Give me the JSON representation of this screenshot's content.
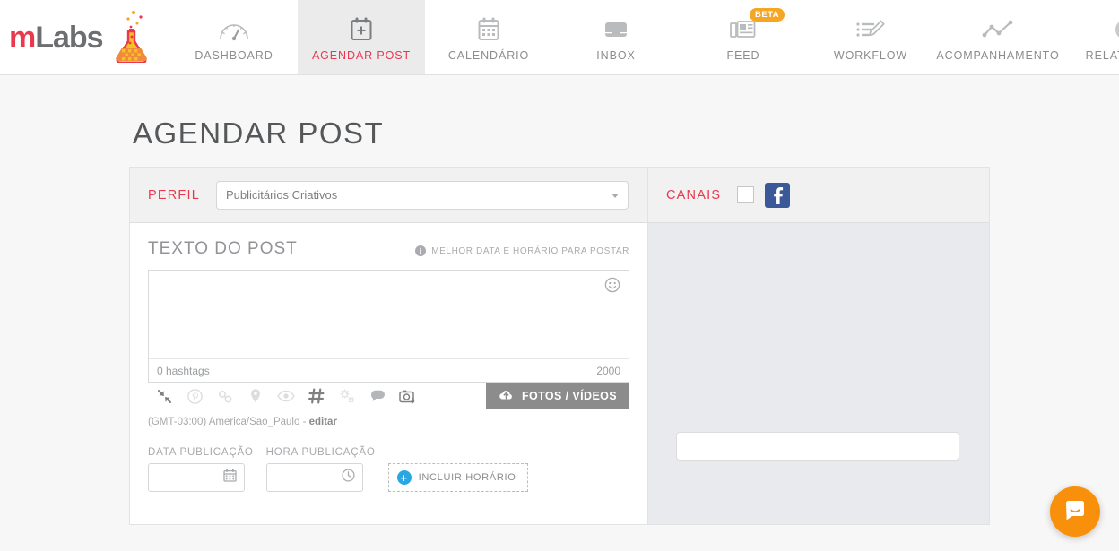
{
  "brand": {
    "name_part1": "m",
    "name_part2": "Labs",
    "accent_red": "#e8394f",
    "gray": "#6d6e70"
  },
  "nav": {
    "items": [
      {
        "label": "DASHBOARD",
        "icon": "gauge-icon",
        "active": false,
        "badge": ""
      },
      {
        "label": "AGENDAR POST",
        "icon": "calendar-plus-icon",
        "active": true,
        "badge": ""
      },
      {
        "label": "CALENDÁRIO",
        "icon": "calendar-icon",
        "active": false,
        "badge": ""
      },
      {
        "label": "INBOX",
        "icon": "inbox-icon",
        "active": false,
        "badge": ""
      },
      {
        "label": "FEED",
        "icon": "newspaper-icon",
        "active": false,
        "badge": "BETA"
      },
      {
        "label": "WORKFLOW",
        "icon": "edit-list-icon",
        "active": false,
        "badge": ""
      },
      {
        "label": "ACOMPANHAMENTO",
        "icon": "line-chart-icon",
        "active": false,
        "badge": ""
      },
      {
        "label": "RELATÓRIOS",
        "icon": "pie-chart-icon",
        "active": false,
        "badge": ""
      }
    ],
    "badge_color": "#f5a623"
  },
  "page": {
    "title": "AGENDAR POST"
  },
  "profile": {
    "label": "PERFIL",
    "selected": "Publicitários Criativos"
  },
  "channels": {
    "label": "CANAIS",
    "checkbox_checked": false,
    "networks": [
      {
        "name": "facebook",
        "glyph": "f",
        "color": "#3b5998"
      }
    ]
  },
  "post": {
    "section_title": "TEXTO DO POST",
    "best_time_label": "MELHOR DATA E HORÁRIO PARA POSTAR",
    "text_value": "",
    "text_placeholder": "",
    "hashtag_count": "0 hashtags",
    "char_counter": "2000",
    "upload_button": "FOTOS / VÍDEOS",
    "timezone_text": "(GMT-03:00) America/Sao_Paulo - ",
    "timezone_edit": "editar",
    "tools": [
      {
        "name": "collapse-icon",
        "state": "enabled"
      },
      {
        "name": "pinterest-icon",
        "state": "disabled"
      },
      {
        "name": "link-icon",
        "state": "disabled"
      },
      {
        "name": "location-pin-icon",
        "state": "disabled"
      },
      {
        "name": "eye-icon",
        "state": "disabled"
      },
      {
        "name": "hashtag-icon",
        "state": "enabled"
      },
      {
        "name": "gears-icon",
        "state": "disabled"
      },
      {
        "name": "comment-icon",
        "state": "enabled"
      },
      {
        "name": "camera-repost-icon",
        "state": "enabled"
      }
    ]
  },
  "schedule": {
    "date_label": "DATA PUBLICAÇÃO",
    "date_value": "",
    "time_label": "HORA PUBLICAÇÃO",
    "time_value": "",
    "add_time_button": "INCLUIR HORÁRIO"
  },
  "chat_widget": {
    "name": "intercom-chat-launcher",
    "color": "#f8900b"
  }
}
